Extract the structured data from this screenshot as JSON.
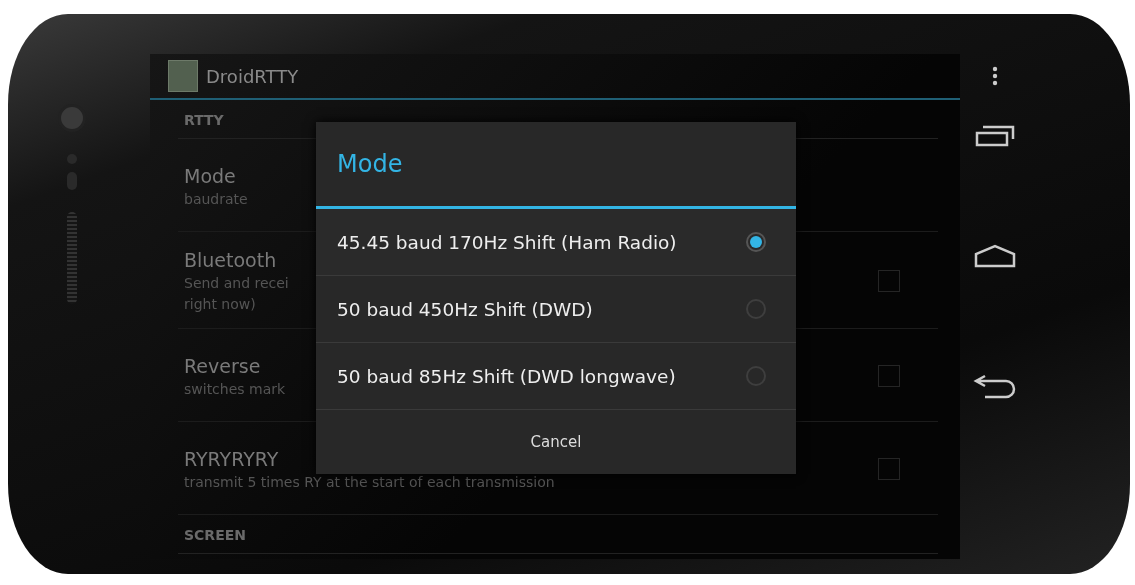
{
  "app_bar": {
    "title": "DroidRTTY"
  },
  "settings": [
    {
      "kind": "category",
      "title": "RTTY"
    },
    {
      "kind": "item",
      "title": "Mode",
      "summary_lines": [
        "baudrate"
      ]
    },
    {
      "kind": "checkbox",
      "title": "Bluetooth",
      "summary_lines": [
        "Send and recei",
        "right now)"
      ],
      "checked": false
    },
    {
      "kind": "checkbox",
      "title": "Reverse",
      "summary_lines": [
        "switches mark"
      ],
      "checked": false
    },
    {
      "kind": "checkbox",
      "title": "RYRYRYRY",
      "summary_lines": [
        "transmit 5 times RY at the start of each transmission"
      ],
      "checked": false
    },
    {
      "kind": "category",
      "title": "SCREEN"
    }
  ],
  "dialog": {
    "title": "Mode",
    "options": [
      {
        "label": "45.45 baud 170Hz Shift (Ham Radio)",
        "selected": true
      },
      {
        "label": "50 baud 450Hz Shift (DWD)",
        "selected": false
      },
      {
        "label": "50 baud 85Hz Shift (DWD longwave)",
        "selected": false
      }
    ],
    "cancel": "Cancel"
  }
}
